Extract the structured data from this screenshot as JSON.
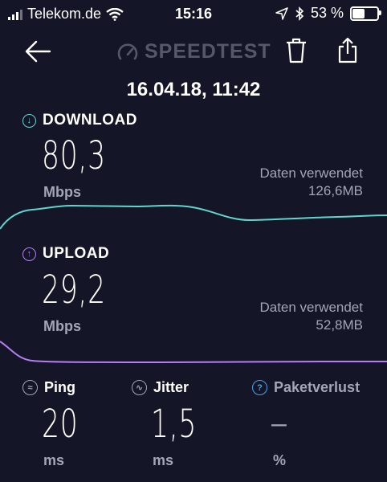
{
  "status_bar": {
    "carrier": "Telekom.de",
    "time": "15:16",
    "battery_text": "53 %",
    "battery_level": 0.53
  },
  "header": {
    "brand": "SPEEDTEST",
    "date": "16.04.18, 11:42"
  },
  "download": {
    "label": "DOWNLOAD",
    "value": "80,3",
    "unit": "Mbps",
    "data_used_label": "Daten verwendet",
    "data_used_value": "126,6MB",
    "color": "#5fd5d0"
  },
  "upload": {
    "label": "UPLOAD",
    "value": "29,2",
    "unit": "Mbps",
    "data_used_label": "Daten verwendet",
    "data_used_value": "52,8MB",
    "color": "#b57ef0"
  },
  "ping": {
    "label": "Ping",
    "value": "20",
    "unit": "ms"
  },
  "jitter": {
    "label": "Jitter",
    "value": "1,5",
    "unit": "ms"
  },
  "packet_loss": {
    "label": "Paketverlust",
    "value": "–",
    "unit": "%",
    "icon_color": "#3fa6f0"
  },
  "icons": {
    "back": "back-arrow-icon",
    "delete": "trash-icon",
    "share": "share-icon",
    "speedometer": "speedometer-icon"
  }
}
